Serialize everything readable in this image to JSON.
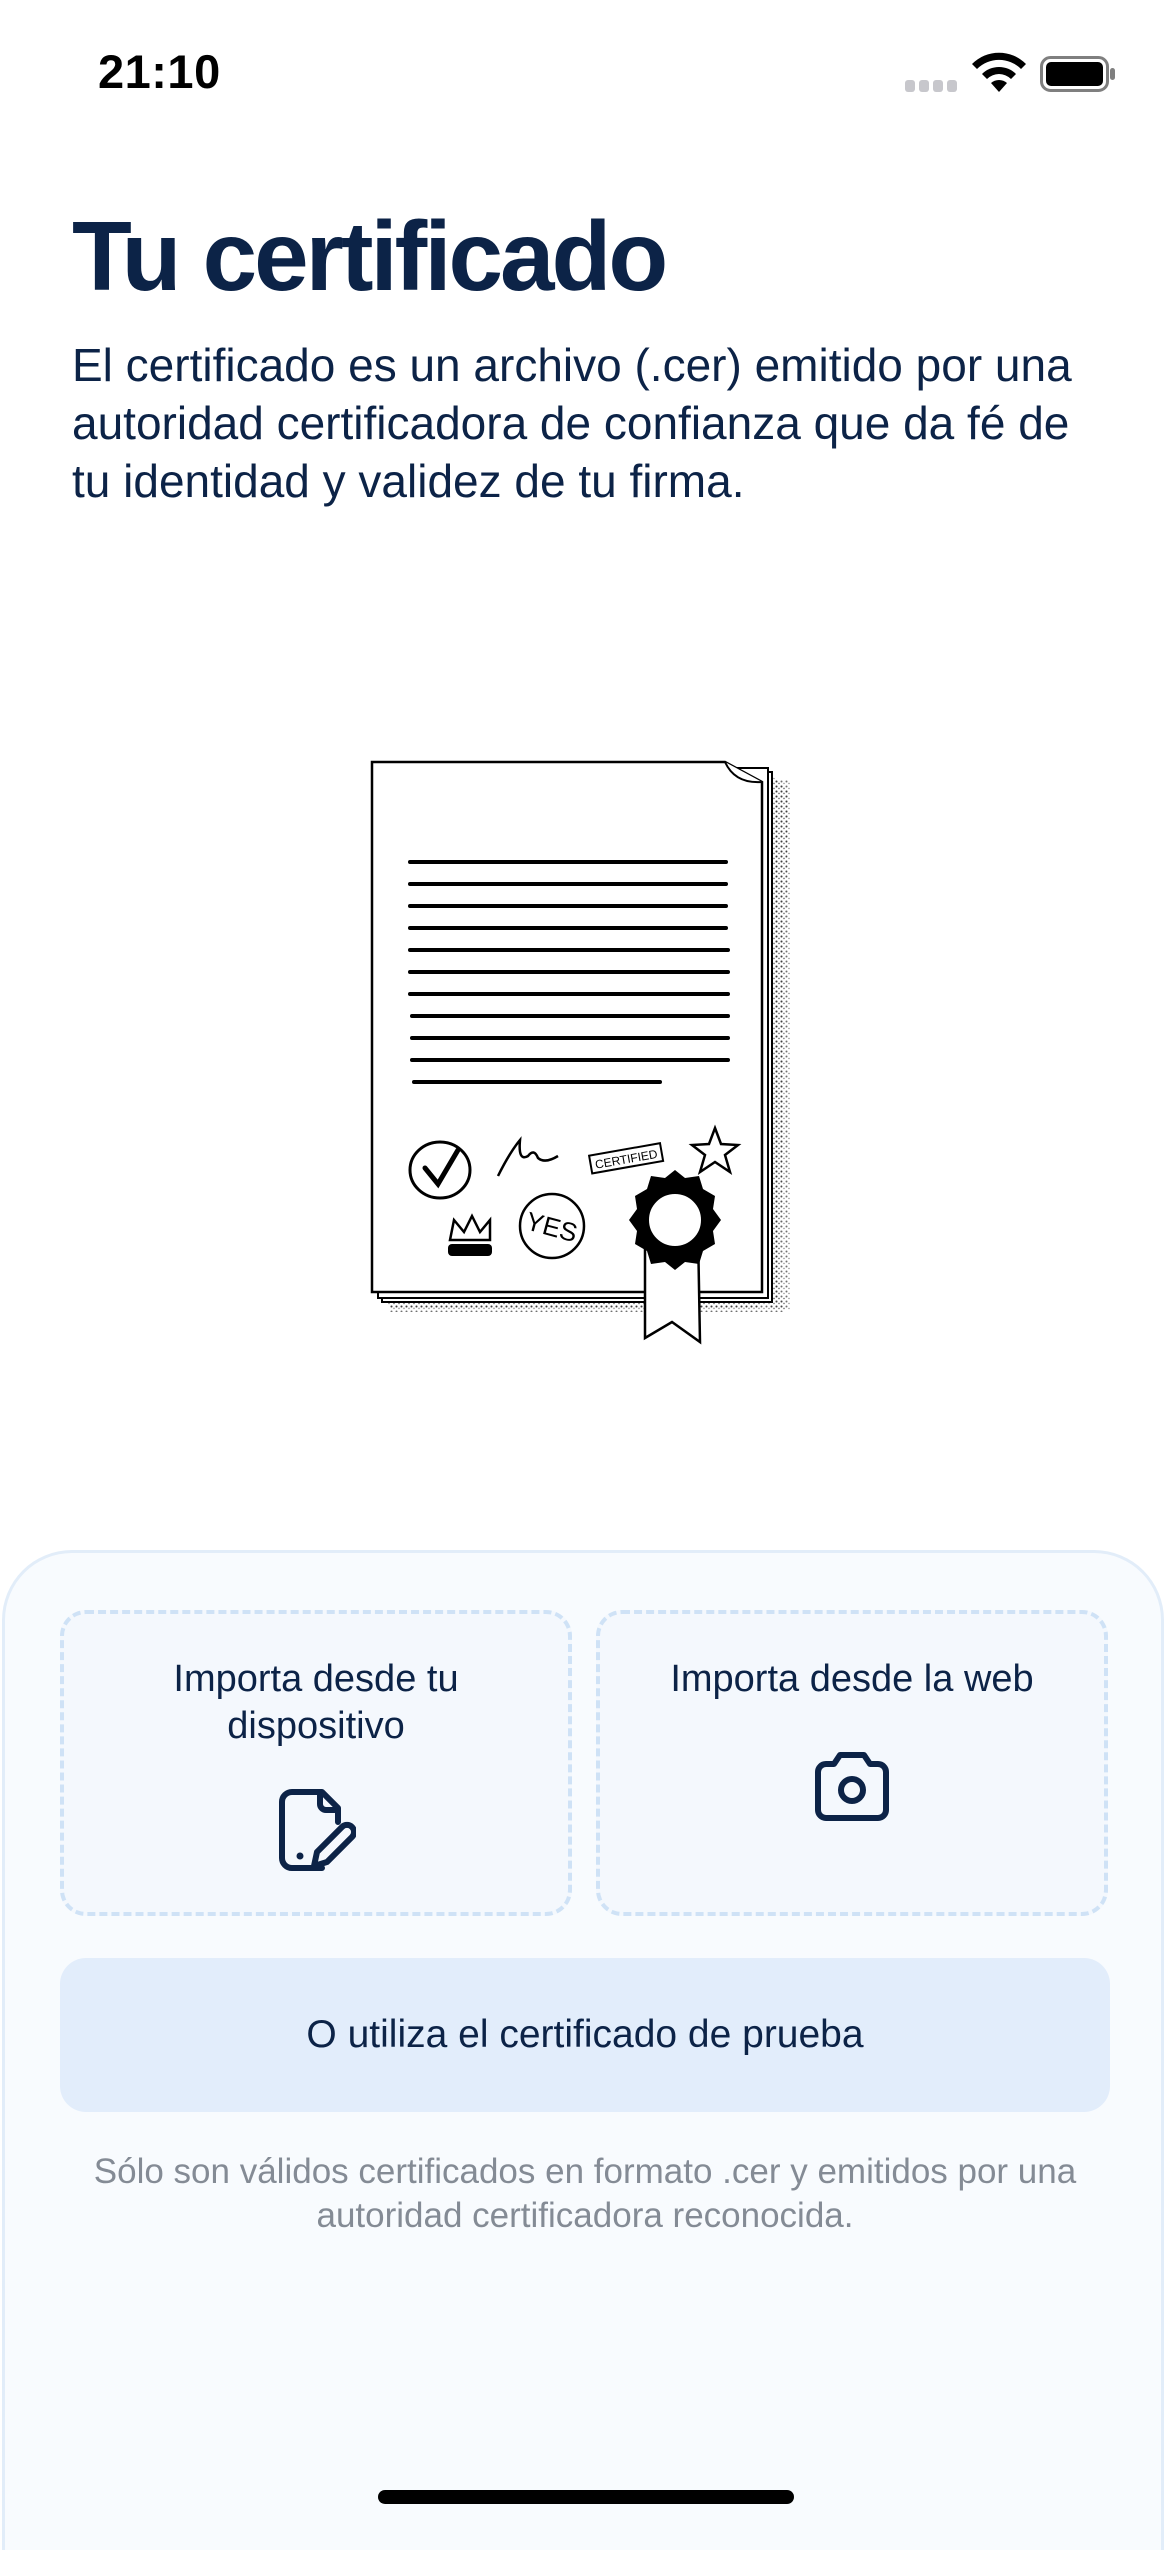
{
  "status_bar": {
    "time": "21:10",
    "signal_icon": "cellular-signal-icon",
    "wifi_icon": "wifi-icon",
    "battery_icon": "battery-full-icon"
  },
  "header": {
    "title": "Tu certificado",
    "description": "El certificado es un archivo (.cer) emitido por una autoridad certificadora de confianza que da fé de tu identidad y validez de tu firma."
  },
  "illustration": {
    "icon": "certificate-document-illustration",
    "stamp_text": "CERTIFIED",
    "seal_text": "YES"
  },
  "import_options": [
    {
      "label": "Importa desde tu dispositivo",
      "icon": "file-edit-icon"
    },
    {
      "label": "Importa desde la web",
      "icon": "camera-icon"
    }
  ],
  "test_certificate_button": "O utiliza el certificado de prueba",
  "footnote": "Sólo son válidos certificados en formato .cer y emitidos por una autoridad certificadora reconocida.",
  "colors": {
    "primary_text": "#0c2347",
    "sheet_background": "#f8fbfe",
    "card_border": "#cfe2f6",
    "button_background": "#e2edfb",
    "muted_text": "#848b95"
  }
}
